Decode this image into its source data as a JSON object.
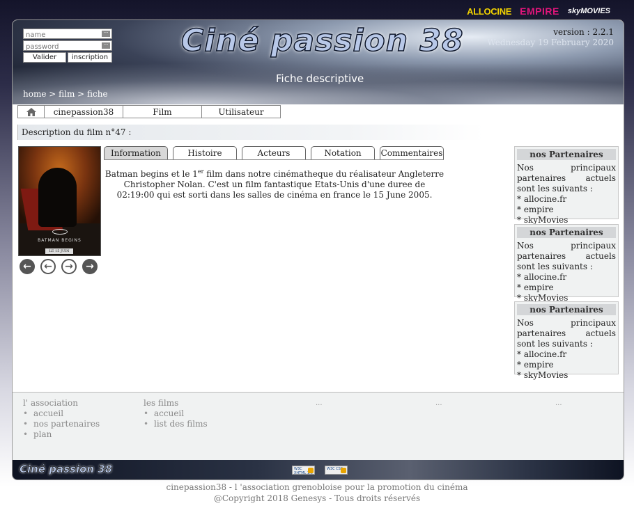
{
  "partners_top": [
    "ALLOCINE",
    "EMPIRE",
    "skyMOVIES"
  ],
  "header": {
    "site_title": "Ciné passion 38",
    "version": "version : 2.2.1",
    "date": "Wednesday 19 February 2020",
    "subtitle": "Fiche descriptive",
    "breadcrumb": "home > film > fiche"
  },
  "login": {
    "name_placeholder": "name",
    "password_placeholder": "password",
    "validate_label": "Valider",
    "register_label": "inscription"
  },
  "nav": {
    "items": [
      "cinepassion38",
      "Film",
      "Utilisateur"
    ]
  },
  "description_title": "Description du film n°47 :",
  "poster": {
    "credits": "",
    "title": "BATMAN BEGINS",
    "date": "LE 15 JUIN"
  },
  "tabs": [
    "Information",
    "Histoire",
    "Acteurs",
    "Notation",
    "Commentaires"
  ],
  "active_tab": "Information",
  "info": {
    "part1": "Batman begins et le 1",
    "sup": "er",
    "part2": " film dans notre cinématheque du réalisateur Angleterre Christopher Nolan. C'est un film fantastique Etats-Unis d'une duree de 02:19:00 qui est sorti dans les salles de cinéma en france le 15 June 2005."
  },
  "sidebar": {
    "boxes": [
      {
        "title": "nos Partenaires",
        "text": "Nos principaux partenaires actuels sont les suivants :",
        "items": [
          "* allocine.fr",
          "* empire",
          "* skyMovies"
        ]
      },
      {
        "title": "nos Partenaires",
        "text": "Nos principaux partenaires actuels sont les suivants :",
        "items": [
          "* allocine.fr",
          "* empire",
          "* skyMovies"
        ]
      },
      {
        "title": "nos Partenaires",
        "text": "Nos principaux partenaires actuels sont les suivants :",
        "items": [
          "* allocine.fr",
          "* empire",
          "* skyMovies"
        ]
      }
    ]
  },
  "footer": {
    "association": {
      "title": "l' association",
      "links": [
        "accueil",
        "nos partenaires",
        "plan"
      ]
    },
    "films": {
      "title": "les films",
      "links": [
        "accueil",
        "list des films"
      ]
    },
    "placeholders": [
      "...",
      "...",
      "..."
    ]
  },
  "bottom_band": {
    "logo": "Ciné passion 38",
    "badges": [
      "W3C XHTML 1.0",
      "W3C CSS"
    ]
  },
  "copyright": {
    "line1": "cinepassion38 - l 'association grenobloise pour la promotion du cinéma",
    "line2": "@Copyright 2018 Genesys - Tous droits réservés"
  }
}
